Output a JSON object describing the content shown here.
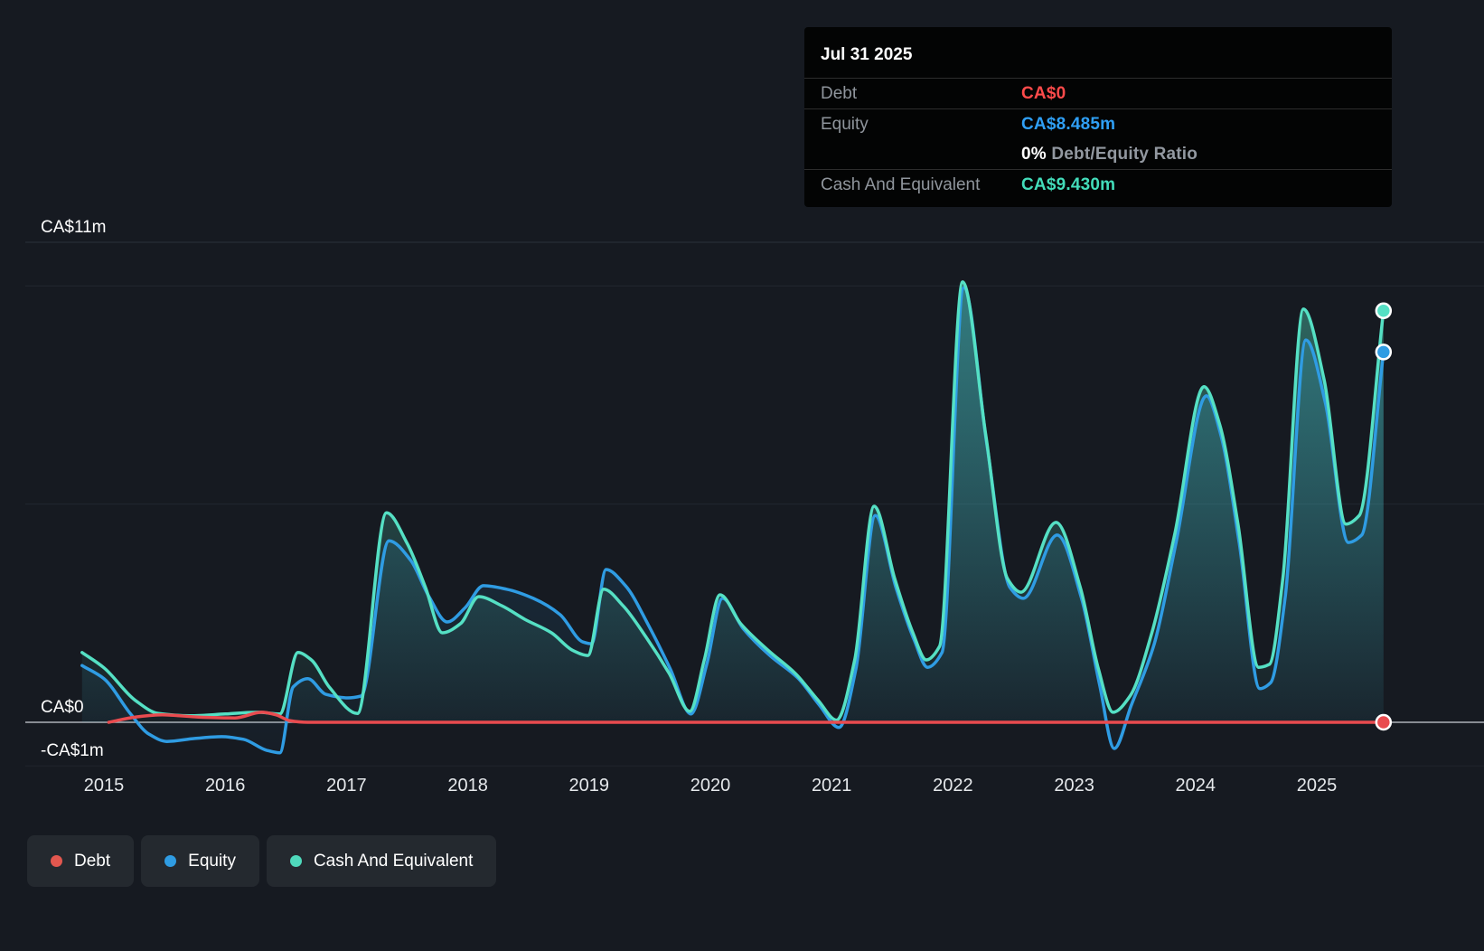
{
  "tooltip": {
    "title": "Jul 31 2025",
    "rows": [
      {
        "label": "Debt",
        "value": "CA$0",
        "value_color": "#ff4b4b",
        "divider_above": false
      },
      {
        "label": "Equity",
        "value": "CA$8.485m",
        "value_color": "#2f9ff5",
        "divider_above": true
      },
      {
        "label": "",
        "segments": [
          {
            "text": "0%",
            "color": "#ffffff",
            "bold": true
          },
          {
            "text": " Debt/Equity Ratio",
            "color": "#9298a0",
            "bold": true
          }
        ],
        "divider_above": false
      },
      {
        "label": "Cash And Equivalent",
        "value": "CA$9.430m",
        "value_color": "#43dcba",
        "divider_above": true
      }
    ]
  },
  "legend": {
    "items": [
      {
        "label": "Debt",
        "color": "#e2574f"
      },
      {
        "label": "Equity",
        "color": "#2f9ce3"
      },
      {
        "label": "Cash And Equivalent",
        "color": "#4fd9bc"
      }
    ]
  },
  "chart_data": {
    "type": "area",
    "title": "Debt to Equity History and Analysis",
    "x_unit": "year",
    "xlim": [
      2014.8,
      2025.6
    ],
    "ylim": [
      -1,
      11
    ],
    "grid": true,
    "legend_position": "bottom-left",
    "y_axis_labels": [
      {
        "value": 11,
        "text": "CA$11m"
      },
      {
        "value": 0,
        "text": "CA$0"
      },
      {
        "value": -1,
        "text": "-CA$1m"
      }
    ],
    "x_ticks": [
      {
        "year": 2015,
        "text": "2015"
      },
      {
        "year": 2016,
        "text": "2016"
      },
      {
        "year": 2017,
        "text": "2017"
      },
      {
        "year": 2018,
        "text": "2018"
      },
      {
        "year": 2019,
        "text": "2019"
      },
      {
        "year": 2020,
        "text": "2020"
      },
      {
        "year": 2021,
        "text": "2021"
      },
      {
        "year": 2022,
        "text": "2022"
      },
      {
        "year": 2023,
        "text": "2023"
      },
      {
        "year": 2024,
        "text": "2024"
      },
      {
        "year": 2025,
        "text": "2025"
      }
    ],
    "gridlines": [
      {
        "value": 11,
        "kind": "top"
      },
      {
        "value": 10,
        "kind": "minor"
      },
      {
        "value": 5,
        "kind": "minor"
      },
      {
        "value": 0,
        "kind": "zero"
      },
      {
        "value": -1,
        "kind": "bottom"
      }
    ],
    "series": [
      {
        "name": "Debt",
        "color": "#e94b4f",
        "area": false,
        "current_value": "CA$0",
        "points": [
          [
            2015.04,
            0
          ],
          [
            2015.26,
            0.12
          ],
          [
            2015.48,
            0.17
          ],
          [
            2015.78,
            0.12
          ],
          [
            2016.08,
            0.1
          ],
          [
            2016.3,
            0.23
          ],
          [
            2016.42,
            0.17
          ],
          [
            2016.53,
            0.04
          ],
          [
            2016.68,
            0
          ],
          [
            2018.0,
            0
          ],
          [
            2020.0,
            0
          ],
          [
            2022.0,
            0
          ],
          [
            2024.0,
            0
          ],
          [
            2025.55,
            0
          ]
        ]
      },
      {
        "name": "Equity",
        "color": "#2f9ce3",
        "area": true,
        "current_value": "CA$8.485m",
        "points": [
          [
            2014.82,
            1.3
          ],
          [
            2015.0,
            1.0
          ],
          [
            2015.22,
            0.19
          ],
          [
            2015.37,
            -0.27
          ],
          [
            2015.52,
            -0.44
          ],
          [
            2015.75,
            -0.37
          ],
          [
            2015.97,
            -0.33
          ],
          [
            2016.15,
            -0.39
          ],
          [
            2016.34,
            -0.64
          ],
          [
            2016.45,
            -0.7
          ],
          [
            2016.56,
            0.81
          ],
          [
            2016.68,
            1.0
          ],
          [
            2016.83,
            0.64
          ],
          [
            2017.01,
            0.56
          ],
          [
            2017.12,
            0.6
          ],
          [
            2017.35,
            4.16
          ],
          [
            2017.53,
            3.71
          ],
          [
            2017.68,
            2.88
          ],
          [
            2017.83,
            2.3
          ],
          [
            2017.98,
            2.63
          ],
          [
            2018.13,
            3.13
          ],
          [
            2018.32,
            3.05
          ],
          [
            2018.54,
            2.84
          ],
          [
            2018.76,
            2.47
          ],
          [
            2018.95,
            1.84
          ],
          [
            2019.02,
            1.8
          ],
          [
            2019.14,
            3.5
          ],
          [
            2019.3,
            3.13
          ],
          [
            2019.49,
            2.22
          ],
          [
            2019.67,
            1.22
          ],
          [
            2019.84,
            0.19
          ],
          [
            2019.97,
            1.33
          ],
          [
            2020.1,
            2.84
          ],
          [
            2020.27,
            2.15
          ],
          [
            2020.49,
            1.53
          ],
          [
            2020.72,
            1.02
          ],
          [
            2020.9,
            0.39
          ],
          [
            2021.06,
            -0.12
          ],
          [
            2021.2,
            1.22
          ],
          [
            2021.36,
            4.74
          ],
          [
            2021.53,
            3.09
          ],
          [
            2021.68,
            1.89
          ],
          [
            2021.79,
            1.26
          ],
          [
            2021.91,
            1.6
          ],
          [
            2022.09,
            9.96
          ],
          [
            2022.28,
            6.36
          ],
          [
            2022.47,
            3.09
          ],
          [
            2022.58,
            2.84
          ],
          [
            2022.86,
            4.29
          ],
          [
            2023.06,
            2.84
          ],
          [
            2023.21,
            0.85
          ],
          [
            2023.33,
            -0.6
          ],
          [
            2023.47,
            0.39
          ],
          [
            2023.66,
            1.8
          ],
          [
            2023.84,
            4.12
          ],
          [
            2024.09,
            7.48
          ],
          [
            2024.21,
            6.57
          ],
          [
            2024.36,
            4.12
          ],
          [
            2024.53,
            0.77
          ],
          [
            2024.62,
            0.91
          ],
          [
            2024.74,
            2.88
          ],
          [
            2024.91,
            8.76
          ],
          [
            2025.07,
            7.33
          ],
          [
            2025.26,
            4.12
          ],
          [
            2025.37,
            4.29
          ],
          [
            2025.55,
            8.485
          ]
        ]
      },
      {
        "name": "Cash And Equivalent",
        "color": "#55e0c4",
        "area": true,
        "current_value": "CA$9.430m",
        "points": [
          [
            2014.82,
            1.6
          ],
          [
            2015.0,
            1.25
          ],
          [
            2015.26,
            0.5
          ],
          [
            2015.45,
            0.2
          ],
          [
            2015.71,
            0.15
          ],
          [
            2016.0,
            0.19
          ],
          [
            2016.27,
            0.23
          ],
          [
            2016.45,
            0.19
          ],
          [
            2016.6,
            1.6
          ],
          [
            2016.71,
            1.43
          ],
          [
            2016.86,
            0.8
          ],
          [
            2017.09,
            0.2
          ],
          [
            2017.33,
            4.8
          ],
          [
            2017.5,
            4.1
          ],
          [
            2017.65,
            3.1
          ],
          [
            2017.79,
            2.05
          ],
          [
            2017.94,
            2.26
          ],
          [
            2018.09,
            2.88
          ],
          [
            2018.28,
            2.67
          ],
          [
            2018.47,
            2.36
          ],
          [
            2018.69,
            2.05
          ],
          [
            2018.87,
            1.64
          ],
          [
            2018.99,
            1.53
          ],
          [
            2019.12,
            3.05
          ],
          [
            2019.28,
            2.67
          ],
          [
            2019.47,
            1.95
          ],
          [
            2019.66,
            1.12
          ],
          [
            2019.83,
            0.25
          ],
          [
            2019.95,
            1.43
          ],
          [
            2020.08,
            2.92
          ],
          [
            2020.25,
            2.26
          ],
          [
            2020.48,
            1.64
          ],
          [
            2020.7,
            1.12
          ],
          [
            2020.89,
            0.5
          ],
          [
            2021.04,
            0.05
          ],
          [
            2021.19,
            1.43
          ],
          [
            2021.35,
            4.95
          ],
          [
            2021.52,
            3.29
          ],
          [
            2021.67,
            2.05
          ],
          [
            2021.78,
            1.43
          ],
          [
            2021.89,
            1.74
          ],
          [
            2022.08,
            10.09
          ],
          [
            2022.27,
            6.6
          ],
          [
            2022.45,
            3.29
          ],
          [
            2022.56,
            2.98
          ],
          [
            2022.85,
            4.58
          ],
          [
            2023.05,
            3.09
          ],
          [
            2023.2,
            1.22
          ],
          [
            2023.32,
            0.23
          ],
          [
            2023.46,
            0.6
          ],
          [
            2023.64,
            2.05
          ],
          [
            2023.83,
            4.33
          ],
          [
            2024.07,
            7.69
          ],
          [
            2024.2,
            6.82
          ],
          [
            2024.35,
            4.54
          ],
          [
            2024.52,
            1.26
          ],
          [
            2024.61,
            1.33
          ],
          [
            2024.72,
            3.29
          ],
          [
            2024.89,
            9.47
          ],
          [
            2025.06,
            7.85
          ],
          [
            2025.24,
            4.54
          ],
          [
            2025.35,
            4.74
          ],
          [
            2025.55,
            9.43
          ]
        ]
      }
    ]
  }
}
